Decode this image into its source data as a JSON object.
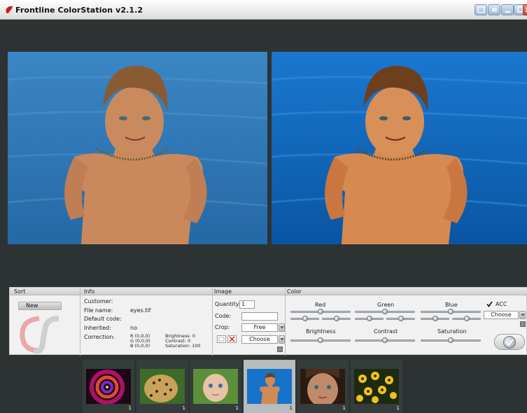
{
  "window": {
    "title": "Frontline ColorStation v2.1.2"
  },
  "sections": {
    "sort": "Sort",
    "info": "Info",
    "image": "Image",
    "color": "Color"
  },
  "sort": {
    "new_label": "New"
  },
  "info": {
    "customer_label": "Customer:",
    "file_name_label": "File name:",
    "file_name_value": "eyes.tif",
    "default_code_label": "Default code:",
    "inherited_label": "Inherited:",
    "inherited_value": "no",
    "correction_label": "Correction:",
    "r_value": "R (0,0,0)",
    "g_value": "G (0,0,0)",
    "b_value": "B (0,0,0)",
    "brightness_value": "Brightness: 0",
    "contrast_value": "Contrast: 0",
    "saturation_value": "Saturation: 100"
  },
  "image": {
    "quantity_label": "Quantity:",
    "quantity_value": "1",
    "code_label": "Code:",
    "code_value": "",
    "crop_label": "Crop:",
    "crop_value": "Free",
    "choose_value": "Choose"
  },
  "color": {
    "red_label": "Red",
    "green_label": "Green",
    "blue_label": "Blue",
    "acc_label": "ACC",
    "acc_checked": true,
    "profile_value": "Choose",
    "brightness_label": "Brightness",
    "contrast_label": "Contrast",
    "saturation_label": "Saturation",
    "red_level": 0.5,
    "green_level": 0.5,
    "blue_level": 0.5,
    "brightness_level": 0.5,
    "contrast_level": 0.5,
    "saturation_level": 0.5
  },
  "thumbnails": [
    {
      "subject": "spiral",
      "count": "1",
      "selected": false
    },
    {
      "subject": "leopard",
      "count": "1",
      "selected": false
    },
    {
      "subject": "baby",
      "count": "1",
      "selected": false
    },
    {
      "subject": "boy-in-water",
      "count": "1",
      "selected": true
    },
    {
      "subject": "girl-eyes",
      "count": "1",
      "selected": false
    },
    {
      "subject": "yellow-flowers",
      "count": "1",
      "selected": false
    }
  ],
  "colors": {
    "background": "#2d3333",
    "panel": "#f1f1f1",
    "water_original": "#2f77b3",
    "water_corrected": "#0e67c1"
  }
}
